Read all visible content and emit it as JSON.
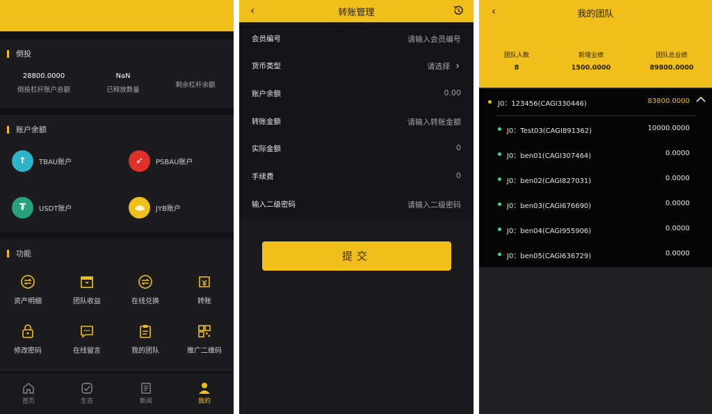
{
  "screen1": {
    "section_invest": {
      "title": "倒投",
      "stats": [
        {
          "value": "28800.0000",
          "label": "倒投杠杆账户总额"
        },
        {
          "value": "NaN",
          "label": "已释放数量"
        },
        {
          "value": "",
          "label": "剩余杠杆余额"
        }
      ]
    },
    "section_balance": {
      "title": "账户余额",
      "accounts": [
        {
          "label": "TBAU账户",
          "icon": "tbau-coin-icon",
          "color": "#2fb3c8"
        },
        {
          "label": "PSBAU账户",
          "icon": "psbau-coin-icon",
          "color": "#e0302a"
        },
        {
          "label": "USDT账户",
          "icon": "usdt-coin-icon",
          "color": "#26a17b"
        },
        {
          "label": "JYB账户",
          "icon": "jyb-coin-icon",
          "color": "#f1bf1b"
        }
      ]
    },
    "section_functions": {
      "title": "功能",
      "items": [
        {
          "label": "资产明细",
          "icon": "exchange-circle-icon"
        },
        {
          "label": "团队收益",
          "icon": "gift-box-icon"
        },
        {
          "label": "在线兑换",
          "icon": "swap-circle-icon"
        },
        {
          "label": "转账",
          "icon": "transfer-icon"
        },
        {
          "label": "修改密码",
          "icon": "lock-icon"
        },
        {
          "label": "在线留言",
          "icon": "message-icon"
        },
        {
          "label": "我的团队",
          "icon": "clipboard-icon"
        },
        {
          "label": "推广二维码",
          "icon": "qrcode-icon"
        }
      ]
    },
    "tabbar": [
      {
        "label": "首页",
        "icon": "home-icon"
      },
      {
        "label": "生态",
        "icon": "ecology-icon"
      },
      {
        "label": "新闻",
        "icon": "news-icon"
      },
      {
        "label": "我的",
        "icon": "user-icon"
      }
    ],
    "active_tab": 3,
    "accent": "#f1bf1b"
  },
  "screen2": {
    "title": "转账管理",
    "back": "‹",
    "fields": [
      {
        "label": "会员编号",
        "value": "请输入会员编号"
      },
      {
        "label": "货币类型",
        "value": "请选择"
      },
      {
        "label": "账户余额",
        "value": "0.00"
      },
      {
        "label": "转账金额",
        "value": "请输入转账金额"
      },
      {
        "label": "实际金额",
        "value": "0"
      },
      {
        "label": "手续费",
        "value": "0"
      },
      {
        "label": "输入二级密码",
        "value": "请输入二级密码"
      }
    ],
    "submit_label": "提交"
  },
  "screen3": {
    "title": "我的团队",
    "back": "‹",
    "stats": [
      {
        "label": "团队人数",
        "value": "8"
      },
      {
        "label": "新增业绩",
        "value": "1500.0000"
      },
      {
        "label": "团队总业绩",
        "value": "89800.0000"
      }
    ],
    "root": {
      "name": "J0：123456(CAGI330446)",
      "amount": "83800.0000"
    },
    "members": [
      {
        "name": "J0：Test03(CAGI891362)",
        "amount": "10000.0000"
      },
      {
        "name": "J0：ben01(CAGI307464)",
        "amount": "0.0000"
      },
      {
        "name": "J0：ben02(CAGI827031)",
        "amount": "0.0000"
      },
      {
        "name": "J0：ben03(CAGI676690)",
        "amount": "0.0000"
      },
      {
        "name": "J0：ben04(CAGI955906)",
        "amount": "0.0000"
      },
      {
        "name": "J0：ben05(CAGI636729)",
        "amount": "0.0000"
      }
    ]
  }
}
